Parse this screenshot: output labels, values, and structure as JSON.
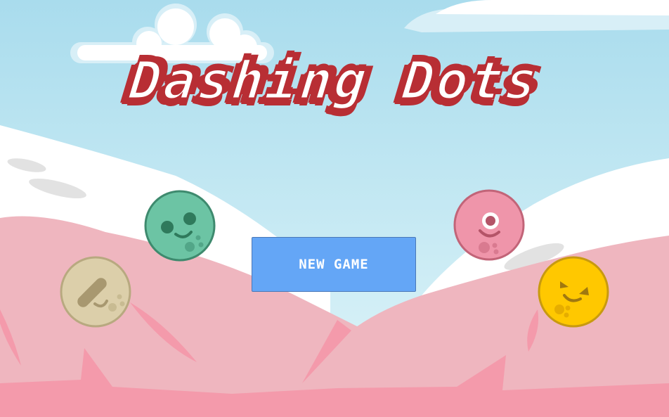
{
  "game": {
    "title": "Dashing Dots",
    "new_game_label": "NEW GAME"
  },
  "characters": [
    {
      "name": "green-dot",
      "color": "#6cc4a4",
      "outline": "#3e8a6e",
      "feature": "#2f7a5c"
    },
    {
      "name": "beige-dot",
      "color": "#dccfaa",
      "outline": "#b8a980",
      "feature": "#a89870"
    },
    {
      "name": "pink-dot",
      "color": "#ef95aa",
      "outline": "#c26478",
      "feature": "#b45468"
    },
    {
      "name": "yellow-dot",
      "color": "#ffc800",
      "outline": "#c89a10",
      "feature": "#a07810"
    }
  ],
  "colors": {
    "sky_top": "#a9dced",
    "sky_bottom": "#def4f8",
    "snow": "#ffffff",
    "mountain_pink": "#efb6bf",
    "mountain_dark": "#f49aab",
    "title_red": "#b82e34",
    "button_blue": "#64a6f6"
  }
}
